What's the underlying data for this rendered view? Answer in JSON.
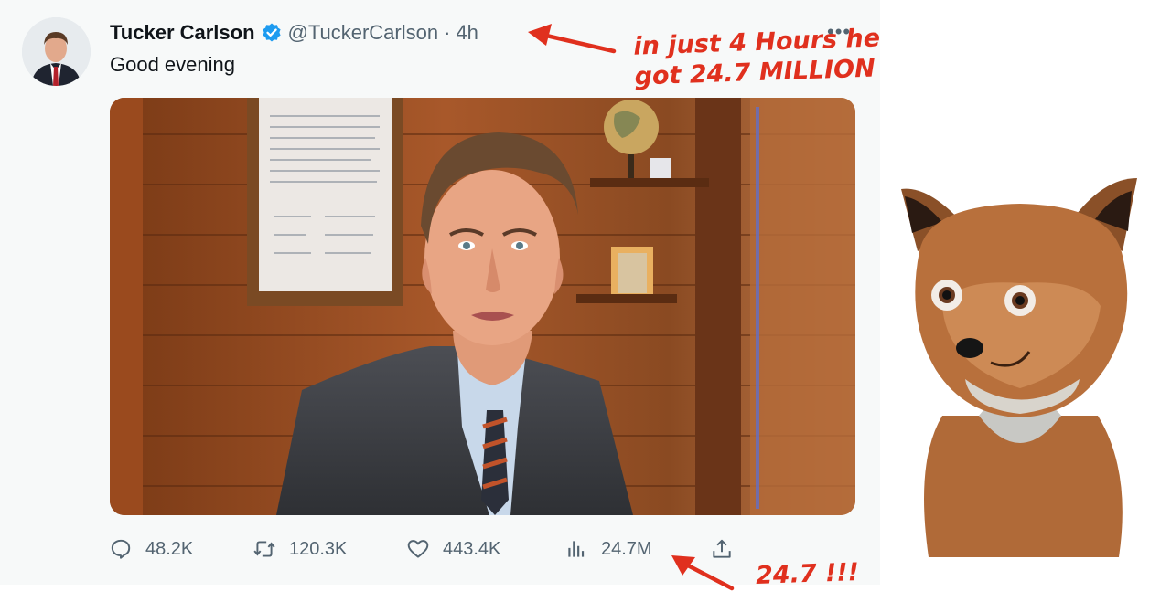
{
  "tweet": {
    "author_name": "Tucker Carlson",
    "verified_icon": "verified-badge-icon",
    "handle": "@TuckerCarlson",
    "separator": "·",
    "age": "4h",
    "more_label": "•••",
    "text": "Good evening"
  },
  "actions": {
    "replies": "48.2K",
    "retweets": "120.3K",
    "likes": "443.4K",
    "views": "24.7M"
  },
  "annotations": {
    "top_line1": "in just 4 Hours he",
    "top_line2": "got 24.7 MILLION",
    "bottom": "24.7 !!!"
  },
  "colors": {
    "annotation_red": "#e0301e",
    "verified_blue": "#1d9bf0",
    "muted_text": "#536471"
  }
}
